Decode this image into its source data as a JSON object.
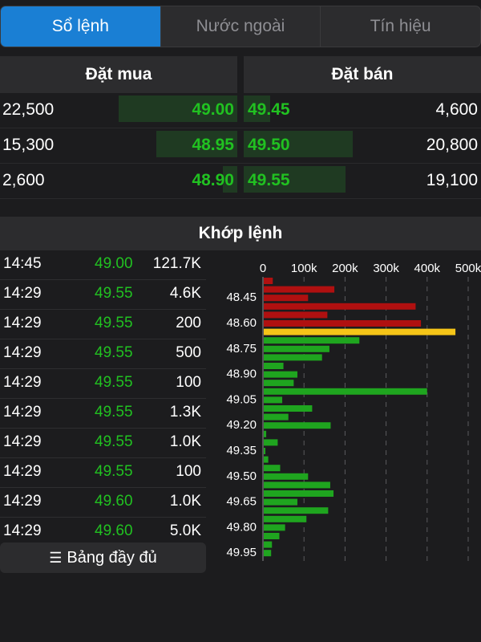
{
  "tabs": [
    {
      "label": "Sổ lệnh",
      "active": true
    },
    {
      "label": "Nước ngoài",
      "active": false
    },
    {
      "label": "Tín hiệu",
      "active": false
    }
  ],
  "order_book": {
    "bid_header": "Đặt mua",
    "ask_header": "Đặt bán",
    "rows": [
      {
        "bid_vol": "22,500",
        "bid_price": "49.00",
        "ask_price": "49.45",
        "ask_vol": "4,600",
        "bid_fill": 0.5,
        "ask_fill": 0.11
      },
      {
        "bid_vol": "15,300",
        "bid_price": "48.95",
        "ask_price": "49.50",
        "ask_vol": "20,800",
        "bid_fill": 0.34,
        "ask_fill": 0.46
      },
      {
        "bid_vol": "2,600",
        "bid_price": "48.90",
        "ask_price": "49.55",
        "ask_vol": "19,100",
        "bid_fill": 0.06,
        "ask_fill": 0.43
      }
    ]
  },
  "matching": {
    "header": "Khớp lệnh",
    "trades": [
      {
        "time": "14:45",
        "price": "49.00",
        "volume": "121.7K"
      },
      {
        "time": "14:29",
        "price": "49.55",
        "volume": "4.6K"
      },
      {
        "time": "14:29",
        "price": "49.55",
        "volume": "200"
      },
      {
        "time": "14:29",
        "price": "49.55",
        "volume": "500"
      },
      {
        "time": "14:29",
        "price": "49.55",
        "volume": "100"
      },
      {
        "time": "14:29",
        "price": "49.55",
        "volume": "1.3K"
      },
      {
        "time": "14:29",
        "price": "49.55",
        "volume": "1.0K"
      },
      {
        "time": "14:29",
        "price": "49.55",
        "volume": "100"
      },
      {
        "time": "14:29",
        "price": "49.60",
        "volume": "1.0K"
      },
      {
        "time": "14:29",
        "price": "49.60",
        "volume": "5.0K"
      }
    ],
    "full_button_label": "Bảng đầy đủ",
    "full_button_icon": "list-icon"
  },
  "chart_data": {
    "type": "bar",
    "orientation": "horizontal",
    "x_ticks": [
      "0",
      "100k",
      "200k",
      "300k",
      "400k",
      "500k"
    ],
    "xlim": [
      0,
      500000
    ],
    "y_labels": [
      "48.45",
      "48.60",
      "48.75",
      "48.90",
      "49.05",
      "49.20",
      "49.35",
      "49.50",
      "49.65",
      "49.80",
      "49.95"
    ],
    "colors": {
      "sell": "#b01010",
      "reference": "#f5c518",
      "buy": "#1fa51f"
    },
    "grid": true,
    "bars": [
      {
        "price": 48.35,
        "volume": 22000,
        "side": "sell"
      },
      {
        "price": 48.4,
        "volume": 172000,
        "side": "sell"
      },
      {
        "price": 48.45,
        "volume": 108000,
        "side": "sell"
      },
      {
        "price": 48.5,
        "volume": 370000,
        "side": "sell"
      },
      {
        "price": 48.55,
        "volume": 155000,
        "side": "sell"
      },
      {
        "price": 48.6,
        "volume": 383000,
        "side": "sell"
      },
      {
        "price": 48.65,
        "volume": 467000,
        "side": "reference"
      },
      {
        "price": 48.7,
        "volume": 233000,
        "side": "buy"
      },
      {
        "price": 48.75,
        "volume": 160000,
        "side": "buy"
      },
      {
        "price": 48.8,
        "volume": 142000,
        "side": "buy"
      },
      {
        "price": 48.85,
        "volume": 48000,
        "side": "buy"
      },
      {
        "price": 48.9,
        "volume": 82000,
        "side": "buy"
      },
      {
        "price": 48.95,
        "volume": 73000,
        "side": "buy"
      },
      {
        "price": 49.0,
        "volume": 398000,
        "side": "buy"
      },
      {
        "price": 49.05,
        "volume": 45000,
        "side": "buy"
      },
      {
        "price": 49.1,
        "volume": 118000,
        "side": "buy"
      },
      {
        "price": 49.15,
        "volume": 60000,
        "side": "buy"
      },
      {
        "price": 49.2,
        "volume": 163000,
        "side": "buy"
      },
      {
        "price": 49.25,
        "volume": 6000,
        "side": "buy"
      },
      {
        "price": 49.3,
        "volume": 34000,
        "side": "buy"
      },
      {
        "price": 49.35,
        "volume": 4000,
        "side": "buy"
      },
      {
        "price": 49.4,
        "volume": 11000,
        "side": "buy"
      },
      {
        "price": 49.45,
        "volume": 40000,
        "side": "buy"
      },
      {
        "price": 49.5,
        "volume": 108000,
        "side": "buy"
      },
      {
        "price": 49.55,
        "volume": 162000,
        "side": "buy"
      },
      {
        "price": 49.6,
        "volume": 170000,
        "side": "buy"
      },
      {
        "price": 49.65,
        "volume": 82000,
        "side": "buy"
      },
      {
        "price": 49.7,
        "volume": 157000,
        "side": "buy"
      },
      {
        "price": 49.75,
        "volume": 104000,
        "side": "buy"
      },
      {
        "price": 49.8,
        "volume": 52000,
        "side": "buy"
      },
      {
        "price": 49.85,
        "volume": 38000,
        "side": "buy"
      },
      {
        "price": 49.9,
        "volume": 20000,
        "side": "buy"
      },
      {
        "price": 49.95,
        "volume": 18000,
        "side": "buy"
      }
    ]
  }
}
